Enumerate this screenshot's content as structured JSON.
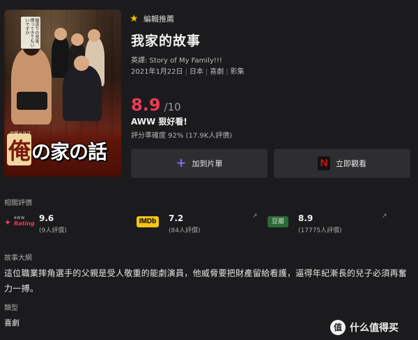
{
  "poster": {
    "tagline": "娘涙りの見本、帰ってきてもいいですか",
    "small_title": "金曜ドラマ",
    "jp_title_first": "俺",
    "jp_title_rest": "の家の話"
  },
  "header": {
    "editor_pick": "編輯推薦",
    "title": "我家的故事",
    "alt_title": "英譯: Story of My Family!!!",
    "date": "2021年1月22日",
    "country": "日本",
    "genre": "喜劇",
    "type": "影集"
  },
  "score": {
    "value": "8.9",
    "max": "/10",
    "verdict": "AWW 狠好看!",
    "accuracy": "評分準確度 92% (17.9K人評價)"
  },
  "buttons": {
    "add_label": "加到片單",
    "watch_label": "立即觀看",
    "netflix_letter": "N"
  },
  "ratings": {
    "section_label": "相關評價",
    "aww": {
      "logo_top": "AWW",
      "logo_main": "Rating",
      "value": "9.6",
      "count": "(9人評價)"
    },
    "imdb": {
      "logo": "IMDb",
      "value": "7.2",
      "count": "(84人評價)"
    },
    "douban": {
      "logo": "豆瓣",
      "value": "8.9",
      "count": "(17775人評價)"
    }
  },
  "synopsis": {
    "label": "故事大綱",
    "text": "這位職業摔角選手的父親是受人敬重的能劇演員，他威脅要把財產留給看護，逼得年紀漸長的兒子必須再奮力一搏。"
  },
  "genre_section": {
    "label": "類型",
    "value": "喜劇"
  },
  "watermark": {
    "icon_char": "值",
    "text": "什么值得买"
  },
  "colors": {
    "accent": "#ec3b57",
    "background": "#1b1b1d",
    "button": "#2e2e31",
    "imdb": "#f5c518",
    "douban": "#2b6a38",
    "netflix": "#e50914"
  }
}
